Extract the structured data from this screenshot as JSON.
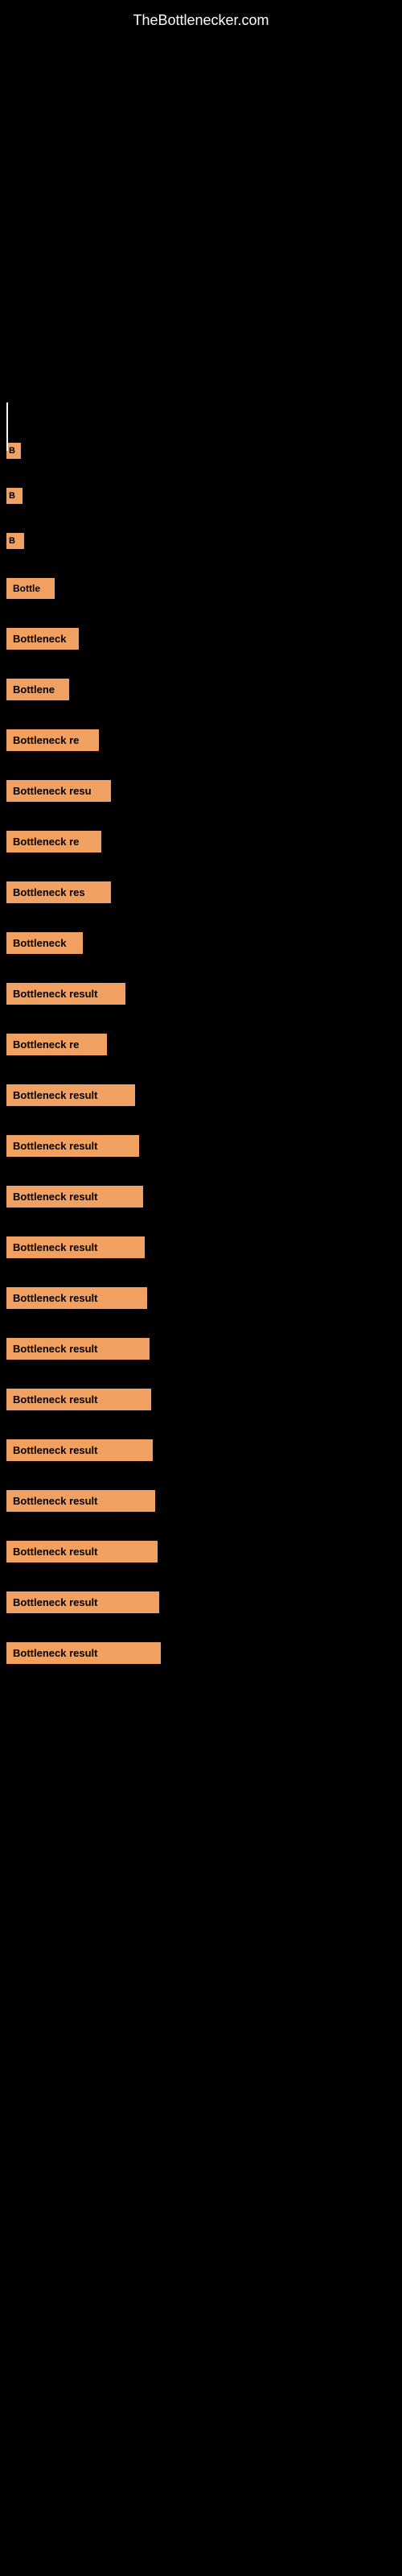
{
  "site": {
    "title": "TheBottlenecker.com"
  },
  "items": [
    {
      "id": 1,
      "label": "B",
      "class": "item-1"
    },
    {
      "id": 2,
      "label": "B",
      "class": "item-2"
    },
    {
      "id": 3,
      "label": "B",
      "class": "item-3"
    },
    {
      "id": 4,
      "label": "Bottle",
      "class": "item-4"
    },
    {
      "id": 5,
      "label": "Bottleneck",
      "class": "item-5"
    },
    {
      "id": 6,
      "label": "Bottlene",
      "class": "item-6"
    },
    {
      "id": 7,
      "label": "Bottleneck re",
      "class": "item-7"
    },
    {
      "id": 8,
      "label": "Bottleneck resu",
      "class": "item-8"
    },
    {
      "id": 9,
      "label": "Bottleneck re",
      "class": "item-9"
    },
    {
      "id": 10,
      "label": "Bottleneck res",
      "class": "item-10"
    },
    {
      "id": 11,
      "label": "Bottleneck",
      "class": "item-11"
    },
    {
      "id": 12,
      "label": "Bottleneck result",
      "class": "item-12"
    },
    {
      "id": 13,
      "label": "Bottleneck re",
      "class": "item-13"
    },
    {
      "id": 14,
      "label": "Bottleneck result",
      "class": "item-14"
    },
    {
      "id": 15,
      "label": "Bottleneck result",
      "class": "item-15"
    },
    {
      "id": 16,
      "label": "Bottleneck result",
      "class": "item-16"
    },
    {
      "id": 17,
      "label": "Bottleneck result",
      "class": "item-17"
    },
    {
      "id": 18,
      "label": "Bottleneck result",
      "class": "item-18"
    },
    {
      "id": 19,
      "label": "Bottleneck result",
      "class": "item-19"
    },
    {
      "id": 20,
      "label": "Bottleneck result",
      "class": "item-20"
    },
    {
      "id": 21,
      "label": "Bottleneck result",
      "class": "item-21"
    },
    {
      "id": 22,
      "label": "Bottleneck result",
      "class": "item-22"
    },
    {
      "id": 23,
      "label": "Bottleneck result",
      "class": "item-23"
    },
    {
      "id": 24,
      "label": "Bottleneck result",
      "class": "item-24"
    },
    {
      "id": 25,
      "label": "Bottleneck result",
      "class": "item-25"
    }
  ],
  "accent_color": "#f0a060"
}
